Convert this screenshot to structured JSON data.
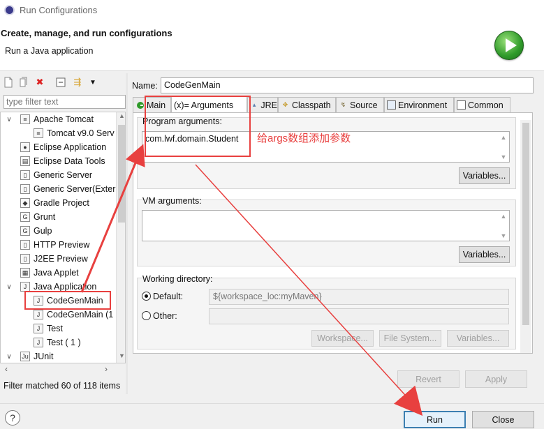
{
  "window": {
    "title": "Run Configurations"
  },
  "header": {
    "title": "Create, manage, and run configurations",
    "subtitle": "Run a Java application"
  },
  "left": {
    "filter_placeholder": "type filter text",
    "tree": [
      {
        "label": "Apache Tomcat",
        "indent": 0,
        "toggle": "∨",
        "icon": "tomcat-icon",
        "glyph": "≡"
      },
      {
        "label": "Tomcat v9.0 Serv",
        "indent": 1,
        "toggle": "",
        "icon": "tomcat-icon",
        "glyph": "≡"
      },
      {
        "label": "Eclipse Application",
        "indent": 0,
        "toggle": "",
        "icon": "eclipse-icon",
        "glyph": "●"
      },
      {
        "label": "Eclipse Data Tools",
        "indent": 0,
        "toggle": "",
        "icon": "data-tools-icon",
        "glyph": "▤"
      },
      {
        "label": "Generic Server",
        "indent": 0,
        "toggle": "",
        "icon": "server-icon",
        "glyph": "▯"
      },
      {
        "label": "Generic Server(Exter",
        "indent": 0,
        "toggle": "",
        "icon": "server-icon",
        "glyph": "▯"
      },
      {
        "label": "Gradle Project",
        "indent": 0,
        "toggle": "",
        "icon": "gradle-icon",
        "glyph": "◆"
      },
      {
        "label": "Grunt",
        "indent": 0,
        "toggle": "",
        "icon": "grunt-icon",
        "glyph": "G"
      },
      {
        "label": "Gulp",
        "indent": 0,
        "toggle": "",
        "icon": "gulp-icon",
        "glyph": "G"
      },
      {
        "label": "HTTP Preview",
        "indent": 0,
        "toggle": "",
        "icon": "http-preview-icon",
        "glyph": "▯"
      },
      {
        "label": "J2EE Preview",
        "indent": 0,
        "toggle": "",
        "icon": "j2ee-preview-icon",
        "glyph": "▯"
      },
      {
        "label": "Java Applet",
        "indent": 0,
        "toggle": "",
        "icon": "applet-icon",
        "glyph": "▦"
      },
      {
        "label": "Java Application",
        "indent": 0,
        "toggle": "∨",
        "icon": "java-app-icon",
        "glyph": "J"
      },
      {
        "label": "CodeGenMain",
        "indent": 1,
        "toggle": "",
        "icon": "java-config-icon",
        "glyph": "J"
      },
      {
        "label": "CodeGenMain (1",
        "indent": 1,
        "toggle": "",
        "icon": "java-config-icon",
        "glyph": "J"
      },
      {
        "label": "Test",
        "indent": 1,
        "toggle": "",
        "icon": "java-config-icon",
        "glyph": "J"
      },
      {
        "label": "Test ( 1 )",
        "indent": 1,
        "toggle": "",
        "icon": "java-config-icon",
        "glyph": "J"
      },
      {
        "label": "JUnit",
        "indent": 0,
        "toggle": "∨",
        "icon": "junit-icon",
        "glyph": "Ju"
      }
    ],
    "status": "Filter matched 60 of 118 items"
  },
  "main": {
    "name_label": "Name:",
    "name_value": "CodeGenMain",
    "tabs": [
      "Main",
      "(x)= Arguments",
      "JRE",
      "Classpath",
      "Source",
      "Environment",
      "Common"
    ],
    "program_args_label": "Program arguments:",
    "program_args_value": "com.lwf.domain.Student",
    "variables_label": "Variables...",
    "vm_args_label": "VM arguments:",
    "working_dir_label": "Working directory:",
    "default_label": "Default:",
    "default_value": "${workspace_loc:myMaven}",
    "other_label": "Other:",
    "workspace_btn": "Workspace...",
    "file_system_btn": "File System...",
    "revert_btn": "Revert",
    "apply_btn": "Apply"
  },
  "footer": {
    "run_btn": "Run",
    "close_btn": "Close"
  },
  "annotation": {
    "text": "给args数组添加参数",
    "color": "#e8403f"
  }
}
